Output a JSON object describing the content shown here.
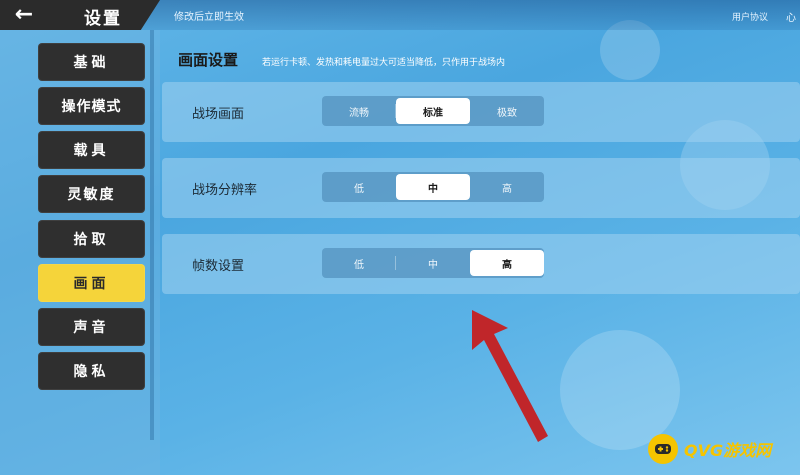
{
  "header": {
    "title": "设置",
    "notice": "修改后立即生效",
    "agreement": "用户协议",
    "heart_glyph": "心"
  },
  "sidebar": {
    "items": [
      {
        "label": "基础"
      },
      {
        "label": "操作模式"
      },
      {
        "label": "载具"
      },
      {
        "label": "灵敏度"
      },
      {
        "label": "拾取"
      },
      {
        "label": "画面",
        "active": true
      },
      {
        "label": "声音"
      },
      {
        "label": "隐私"
      }
    ]
  },
  "main": {
    "section_title": "画面设置",
    "section_desc": "若运行卡顿、发热和耗电量过大可适当降低，只作用于战场内",
    "rows": [
      {
        "label": "战场画面",
        "options": [
          "流畅",
          "标准",
          "极致"
        ],
        "selected": "标准"
      },
      {
        "label": "战场分辨率",
        "options": [
          "低",
          "中",
          "高"
        ],
        "selected": "中"
      },
      {
        "label": "帧数设置",
        "options": [
          "低",
          "中",
          "高"
        ],
        "selected": "高"
      }
    ]
  },
  "watermark": {
    "text": "QVG游戏网"
  },
  "colors": {
    "active_tab": "#f5d43a",
    "inactive_tab": "#2f2f2f",
    "arrow": "#c0262a",
    "watermark": "#f5c400"
  }
}
